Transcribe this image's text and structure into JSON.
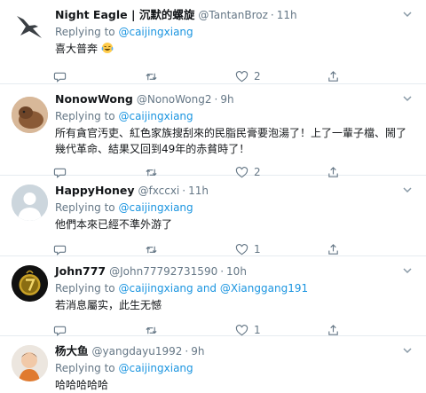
{
  "tweets": [
    {
      "name": "Night Eagle | 沉默的螺旋",
      "handle": "@TantanBroz",
      "dot": "·",
      "time": "11h",
      "reply_prefix": "Replying to ",
      "mentions": [
        "@caijingxiang"
      ],
      "mention_joiner": "",
      "text": "喜大普奔",
      "emoji": "face-with-tears-of-joy",
      "counts": {
        "reply": "",
        "retweet": "",
        "like": "2",
        "share": ""
      }
    },
    {
      "name": "NonowWong",
      "handle": "@NonoWong2",
      "dot": "·",
      "time": "9h",
      "reply_prefix": "Replying to ",
      "mentions": [
        "@caijingxiang"
      ],
      "mention_joiner": "",
      "text": "所有貪官汚吏、紅色家族搜刮來的民脂民膏要泡湯了！上了一輩子檔、鬧了幾代革命、結果又回到49年的赤貧時了！",
      "counts": {
        "reply": "",
        "retweet": "",
        "like": "2",
        "share": ""
      }
    },
    {
      "name": "HappyHoney",
      "handle": "@fxccxi",
      "dot": "·",
      "time": "11h",
      "reply_prefix": "Replying to ",
      "mentions": [
        "@caijingxiang"
      ],
      "mention_joiner": "",
      "text": "他們本來已經不準外游了",
      "counts": {
        "reply": "",
        "retweet": "",
        "like": "1",
        "share": ""
      }
    },
    {
      "name": "John777",
      "handle": "@John77792731590",
      "dot": "·",
      "time": "10h",
      "reply_prefix": "Replying to ",
      "mentions": [
        "@caijingxiang",
        "@Xianggang191"
      ],
      "mention_joiner": " and ",
      "text": "若消息屬实，此生无憾",
      "counts": {
        "reply": "",
        "retweet": "",
        "like": "1",
        "share": ""
      }
    },
    {
      "name": "杨大鱼",
      "handle": "@yangdayu1992",
      "dot": "·",
      "time": "9h",
      "reply_prefix": "Replying to ",
      "mentions": [
        "@caijingxiang"
      ],
      "mention_joiner": "",
      "text": "哈哈哈哈哈",
      "counts": {
        "reply": "",
        "retweet": "",
        "like": "",
        "share": ""
      }
    }
  ],
  "colors": {
    "mention": "#1b95e0",
    "secondary": "#657786",
    "divider": "#e6ecf0"
  }
}
